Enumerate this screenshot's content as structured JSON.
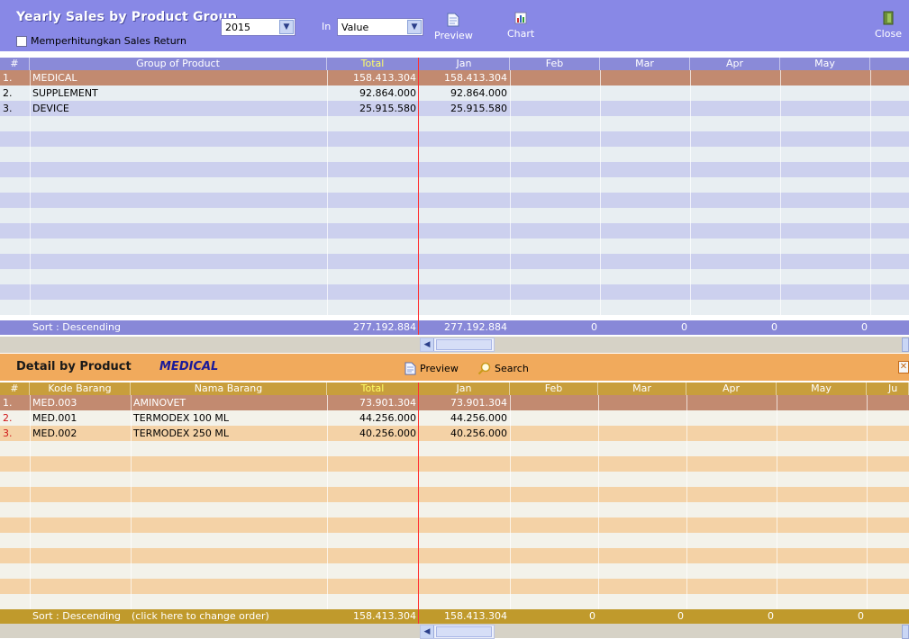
{
  "window": {
    "title": "Yearly Sales by Product Group",
    "year_value": "2015",
    "in_label": "In",
    "measure_value": "Value",
    "sales_return_label": "Memperhitungkan Sales Return",
    "preview_label": "Preview",
    "chart_label": "Chart",
    "close_label": "Close"
  },
  "top_grid": {
    "columns": [
      "#",
      "Group of Product",
      "Total",
      "Jan",
      "Feb",
      "Mar",
      "Apr",
      "May"
    ],
    "rows": [
      {
        "no": "1.",
        "group": "MEDICAL",
        "total": "158.413.304",
        "jan": "158.413.304"
      },
      {
        "no": "2.",
        "group": "SUPPLEMENT",
        "total": "92.864.000",
        "jan": "92.864.000"
      },
      {
        "no": "3.",
        "group": "DEVICE",
        "total": "25.915.580",
        "jan": "25.915.580"
      }
    ],
    "footer": {
      "sort": "Sort : Descending",
      "total": "277.192.884",
      "jan": "277.192.884",
      "feb": "0",
      "mar": "0",
      "apr": "0",
      "may": "0"
    }
  },
  "detail": {
    "title": "Detail by Product",
    "group": "MEDICAL",
    "preview_label": "Preview",
    "search_label": "Search"
  },
  "bottom_grid": {
    "columns": [
      "#",
      "Kode Barang",
      "Nama Barang",
      "Total",
      "Jan",
      "Feb",
      "Mar",
      "Apr",
      "May",
      "Ju"
    ],
    "rows": [
      {
        "no": "1.",
        "code": "MED.003",
        "name": "AMINOVET",
        "total": "73.901.304",
        "jan": "73.901.304"
      },
      {
        "no": "2.",
        "code": "MED.001",
        "name": "TERMODEX 100 ML",
        "total": "44.256.000",
        "jan": "44.256.000"
      },
      {
        "no": "3.",
        "code": "MED.002",
        "name": "TERMODEX 250 ML",
        "total": "40.256.000",
        "jan": "40.256.000"
      }
    ],
    "footer": {
      "sort": "Sort : Descending",
      "hint": "(click here to change order)",
      "total": "158.413.304",
      "jan": "158.413.304",
      "feb": "0",
      "mar": "0",
      "apr": "0",
      "may": "0"
    }
  },
  "colors": {
    "top_header": "#8888e6",
    "detail_header": "#f1aa5c",
    "selected_row": "#c28a70",
    "total_header_text": "#ffff66",
    "current_month_line": "#ff3030"
  }
}
